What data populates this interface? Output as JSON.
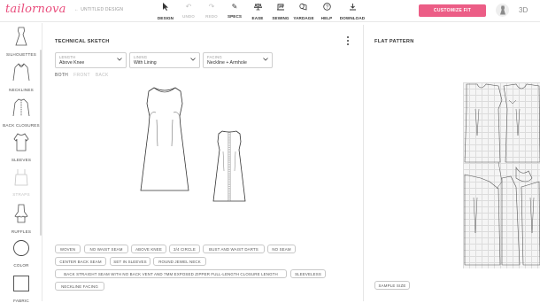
{
  "header": {
    "logo_text": "tailornova",
    "design_name": "UNTITLED DESIGN",
    "tools": [
      {
        "label": "DESIGN",
        "icon": "cursor-icon",
        "disabled": false
      },
      {
        "label": "UNDO",
        "icon": "undo-icon",
        "disabled": true
      },
      {
        "label": "REDO",
        "icon": "redo-icon",
        "disabled": true
      },
      {
        "label": "SPECS",
        "icon": "pencil-icon",
        "disabled": false
      },
      {
        "label": "EASE",
        "icon": "scale-icon",
        "disabled": false
      },
      {
        "label": "SEWING",
        "icon": "sewing-machine-icon",
        "disabled": false
      },
      {
        "label": "YARDAGE",
        "icon": "fabric-roll-icon",
        "disabled": false
      },
      {
        "label": "HELP",
        "icon": "help-icon",
        "disabled": false
      },
      {
        "label": "DOWNLOAD",
        "icon": "download-icon",
        "disabled": false
      }
    ],
    "customize_label": "CUSTOMIZE FIT",
    "view_3d_label": "3D",
    "accent_color": "#ec5d86"
  },
  "sidebar": {
    "items": [
      {
        "label": "SILHOUETTES",
        "icon": "silhouette-icon",
        "disabled": false
      },
      {
        "label": "NECKLINES",
        "icon": "neckline-icon",
        "disabled": false
      },
      {
        "label": "BACK CLOSURES",
        "icon": "back-closure-icon",
        "disabled": false
      },
      {
        "label": "SLEEVES",
        "icon": "sleeve-icon",
        "disabled": false
      },
      {
        "label": "STRAPS",
        "icon": "strap-icon",
        "disabled": true
      },
      {
        "label": "RUFFLES",
        "icon": "ruffle-icon",
        "disabled": false
      },
      {
        "label": "COLOR",
        "icon": "color-circle-icon",
        "disabled": false
      },
      {
        "label": "FABRIC",
        "icon": "fabric-swatch-icon",
        "disabled": false
      }
    ]
  },
  "technical_sketch": {
    "title": "TECHNICAL SKETCH",
    "length": {
      "caption": "LENGTH",
      "value": "Above Knee"
    },
    "lining": {
      "caption": "LINING",
      "value": "With Lining"
    },
    "facing": {
      "caption": "FACING",
      "value": "Neckline + Armhole"
    },
    "views": {
      "both": "BOTH",
      "front": "FRONT",
      "back": "BACK"
    },
    "tags": [
      "WOVEN",
      "NO WAIST SEAM",
      "ABOVE KNEE",
      "3/4 CIRCLE",
      "BUST AND WAIST DARTS",
      "NO SEAM",
      "CENTER BACK SEAM",
      "SET IN SLEEVES",
      "ROUND JEWEL NECK",
      "BACK STRAIGHT SEAM WITH NO BACK VENT AND 7MM EXPOSED ZIPPER FULL-LENGTH CLOSURE LENGTH",
      "SLEEVELESS",
      "NECKLINE FACING"
    ]
  },
  "flat_pattern": {
    "title": "FLAT PATTERN",
    "sample_size_label": "SAMPLE SIZE"
  }
}
